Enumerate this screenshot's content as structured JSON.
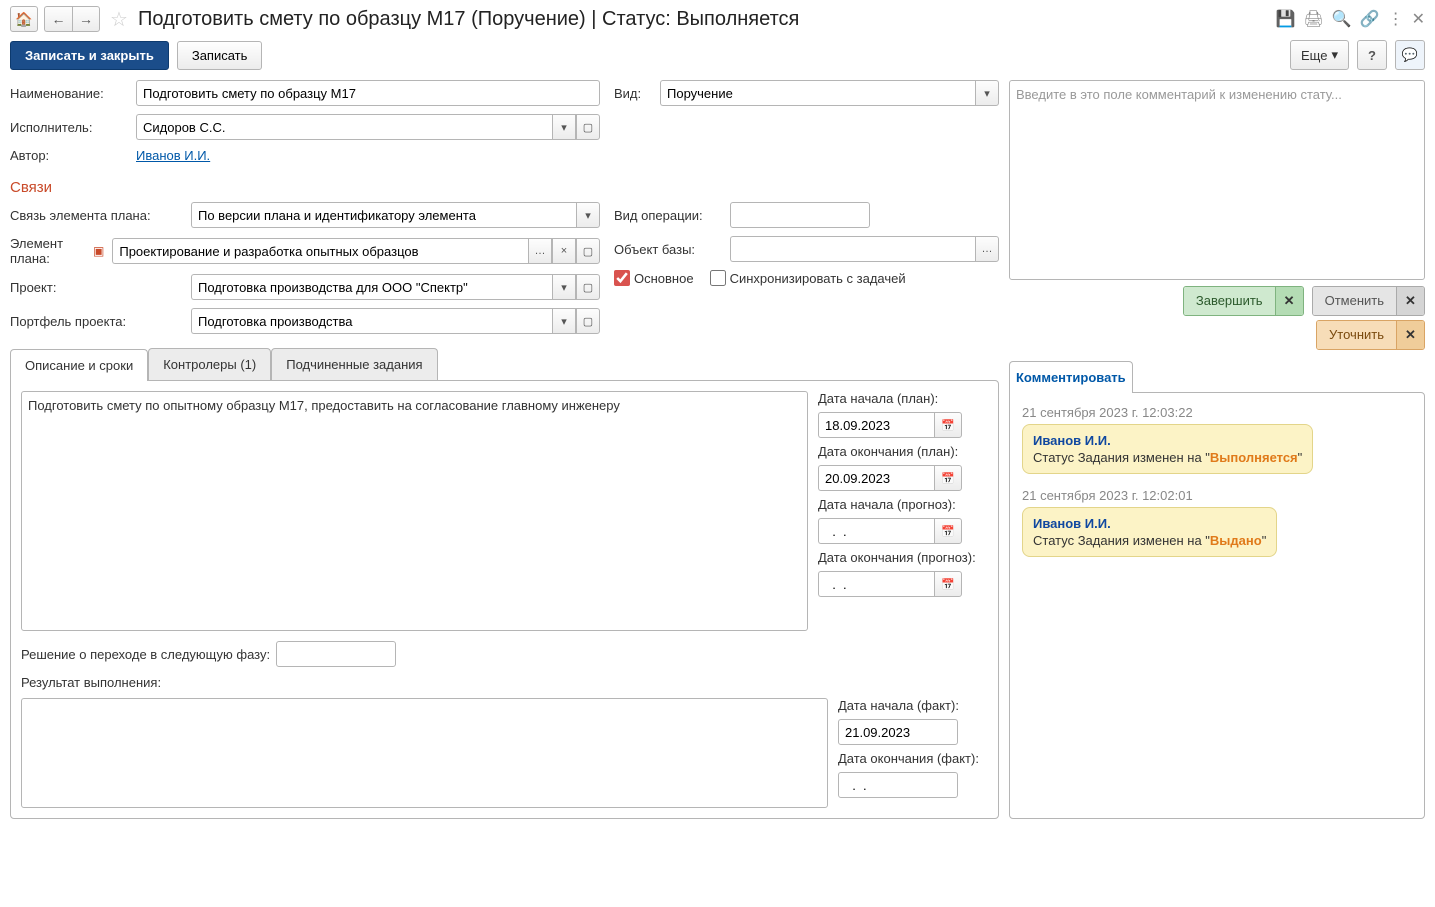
{
  "header": {
    "title": "Подготовить смету по образцу М17 (Поручение) | Статус: Выполняется"
  },
  "actions": {
    "save_close": "Записать и закрыть",
    "save": "Записать",
    "more": "Еще",
    "help": "?"
  },
  "form": {
    "name_label": "Наименование:",
    "name_value": "Подготовить смету по образцу М17",
    "type_label": "Вид:",
    "type_value": "Поручение",
    "executor_label": "Исполнитель:",
    "executor_value": "Сидоров С.С.",
    "author_label": "Автор:",
    "author_value": "Иванов И.И."
  },
  "links_section": {
    "title": "Связи",
    "link_type_label": "Связь элемента плана:",
    "link_type_value": "По версии плана и идентификатору элемента",
    "plan_element_label": "Элемент плана:",
    "plan_element_value": "Проектирование и разработка опытных образцов",
    "project_label": "Проект:",
    "project_value": "Подготовка производства для ООО \"Спектр\"",
    "portfolio_label": "Портфель проекта:",
    "portfolio_value": "Подготовка производства",
    "op_type_label": "Вид операции:",
    "base_obj_label": "Объект базы:",
    "main_label": "Основное",
    "sync_label": "Синхронизировать с задачей"
  },
  "tabs": {
    "desc": "Описание и сроки",
    "controllers": "Контролеры (1)",
    "subtasks": "Подчиненные задания"
  },
  "desc_tab": {
    "text": "Подготовить смету по опытному образцу М17, предоставить на согласование главному инженеру",
    "start_plan_label": "Дата начала (план):",
    "start_plan": "18.09.2023",
    "end_plan_label": "Дата окончания (план):",
    "end_plan": "20.09.2023",
    "start_fc_label": "Дата начала (прогноз):",
    "start_fc": "  .  .",
    "end_fc_label": "Дата окончания (прогноз):",
    "end_fc": "  .  .",
    "phase_label": "Решение о переходе в следующую фазу:",
    "result_label": "Результат выполнения:",
    "start_fact_label": "Дата начала (факт):",
    "start_fact": "21.09.2023",
    "end_fact_label": "Дата окончания (факт):",
    "end_fact": "  .  ."
  },
  "right": {
    "comment_placeholder": "Введите в это поле комментарий к изменению стату...",
    "complete": "Завершить",
    "cancel": "Отменить",
    "clarify": "Уточнить",
    "comment_action": "Комментировать"
  },
  "history": [
    {
      "ts": "21 сентября 2023 г. 12:03:22",
      "author": "Иванов И.И.",
      "text_prefix": "Статус Задания изменен на \"",
      "status": "Выполняется",
      "text_suffix": "\""
    },
    {
      "ts": "21 сентября 2023 г. 12:02:01",
      "author": "Иванов И.И.",
      "text_prefix": "Статус Задания изменен на \"",
      "status": "Выдано",
      "text_suffix": "\""
    }
  ]
}
